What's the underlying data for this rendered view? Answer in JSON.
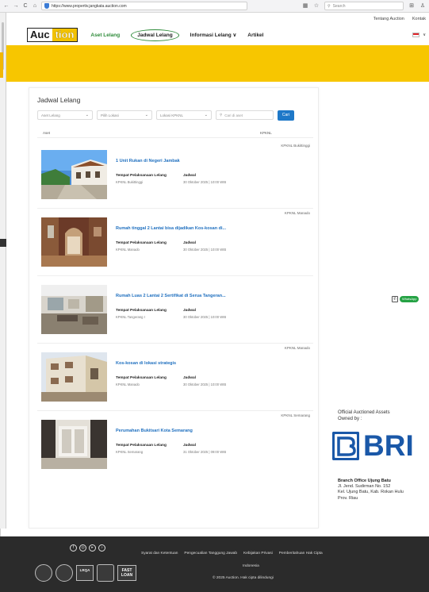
{
  "browser": {
    "url": "https://www.propertiv.jangkata.auction.com",
    "search_placeholder": "Search",
    "nav_back": "←",
    "nav_forward": "→",
    "nav_reload": "C",
    "nav_home": "⌂"
  },
  "top_links": [
    "Tentang Auction",
    "Kontak"
  ],
  "header": {
    "logo_part1": "Auc",
    "logo_part2": "tion",
    "menu": [
      "Aset Lelang",
      "Jadwal Lelang",
      "Informasi Lelang ∨",
      "Artikel"
    ],
    "lang_caret": "∨"
  },
  "page": {
    "title": "Jadwal Lelang",
    "filters": [
      "Aset Lelang",
      "Pilih Lokasi",
      "Lokasi KPKNL"
    ],
    "search_placeholder": "Cari di aset",
    "search_button": "Cari",
    "columns": {
      "asset": "Aset",
      "kpknl": "KPKNL"
    }
  },
  "listings": [
    {
      "location": "KPKNL Bukittinggi",
      "title": "1 Unit Rukan di Negeri Jambak",
      "place_label": "Tempat Pelaksanaan Lelang",
      "place_value": "KPKNL Bukittinggi",
      "sched_label": "Jadwal",
      "sched_value": "30 Oktober 2025 | 10:00 WIB"
    },
    {
      "location": "KPKNL Manado",
      "title": "Rumah tinggal 2 Lantai bisa dijadikan Kos-kosan di...",
      "place_label": "Tempat Pelaksanaan Lelang",
      "place_value": "KPKNL Manado",
      "sched_label": "Jadwal",
      "sched_value": "30 Oktober 2025 | 10:00 WIB"
    },
    {
      "location": "",
      "title": "Rumah Luas 2 Lantai 2 Sertifikat di Serua Tangeran...",
      "place_label": "Tempat Pelaksanaan Lelang",
      "place_value": "KPKNL Tangerang I",
      "sched_label": "Jadwal",
      "sched_value": "30 Oktober 2025 | 10:00 WIB"
    },
    {
      "location": "KPKNL Manado",
      "title": "Kos-kosan di lokasi strategis",
      "place_label": "Tempat Pelaksanaan Lelang",
      "place_value": "KPKNL Manado",
      "sched_label": "Jadwal",
      "sched_value": "30 Oktober 2025 | 10:00 WIB"
    },
    {
      "location": "KPKNL Semarang",
      "title": "Perumahan Bukitsari Kota Semarang",
      "place_label": "Tempat Pelaksanaan Lelang",
      "place_value": "KPKNL Semarang",
      "sched_label": "Jadwal",
      "sched_value": "31 Oktober 2025 | 09:00 WIB"
    }
  ],
  "sidebar": {
    "whatsapp": "WhatsApp",
    "owned_line1": "Official Auctioned Assets",
    "owned_line2": "Owned by :",
    "bri": "BRI",
    "branch_title": "Branch Office Ujung Batu",
    "branch_lines": [
      "Jl. Jend. Sudirman No. 152",
      "Kel. Ujung Batu, Kab. Rokan Hulu",
      "Prov. Riau"
    ]
  },
  "footer": {
    "links": [
      "Syarat dan Ketentuan",
      "Pengecualian Tanggung Jawab",
      "Kebijakan Privasi",
      "Pemberitahuan Hak Cipta"
    ],
    "country": "Indonesia",
    "copyright": "© 2025  Auction.  Hak cipta dilindungi",
    "badge_lrqa": "LRQA",
    "badge_fastloan1": "FAST",
    "badge_fastloan2": "LOAN"
  },
  "colors": {
    "accent_yellow": "#f7c600",
    "link_blue": "#1e6fbf",
    "button_blue": "#1e78c8",
    "menu_green": "#2e8b3a",
    "footer_bg": "#2b2b2b",
    "bri_blue": "#1a58a8"
  }
}
